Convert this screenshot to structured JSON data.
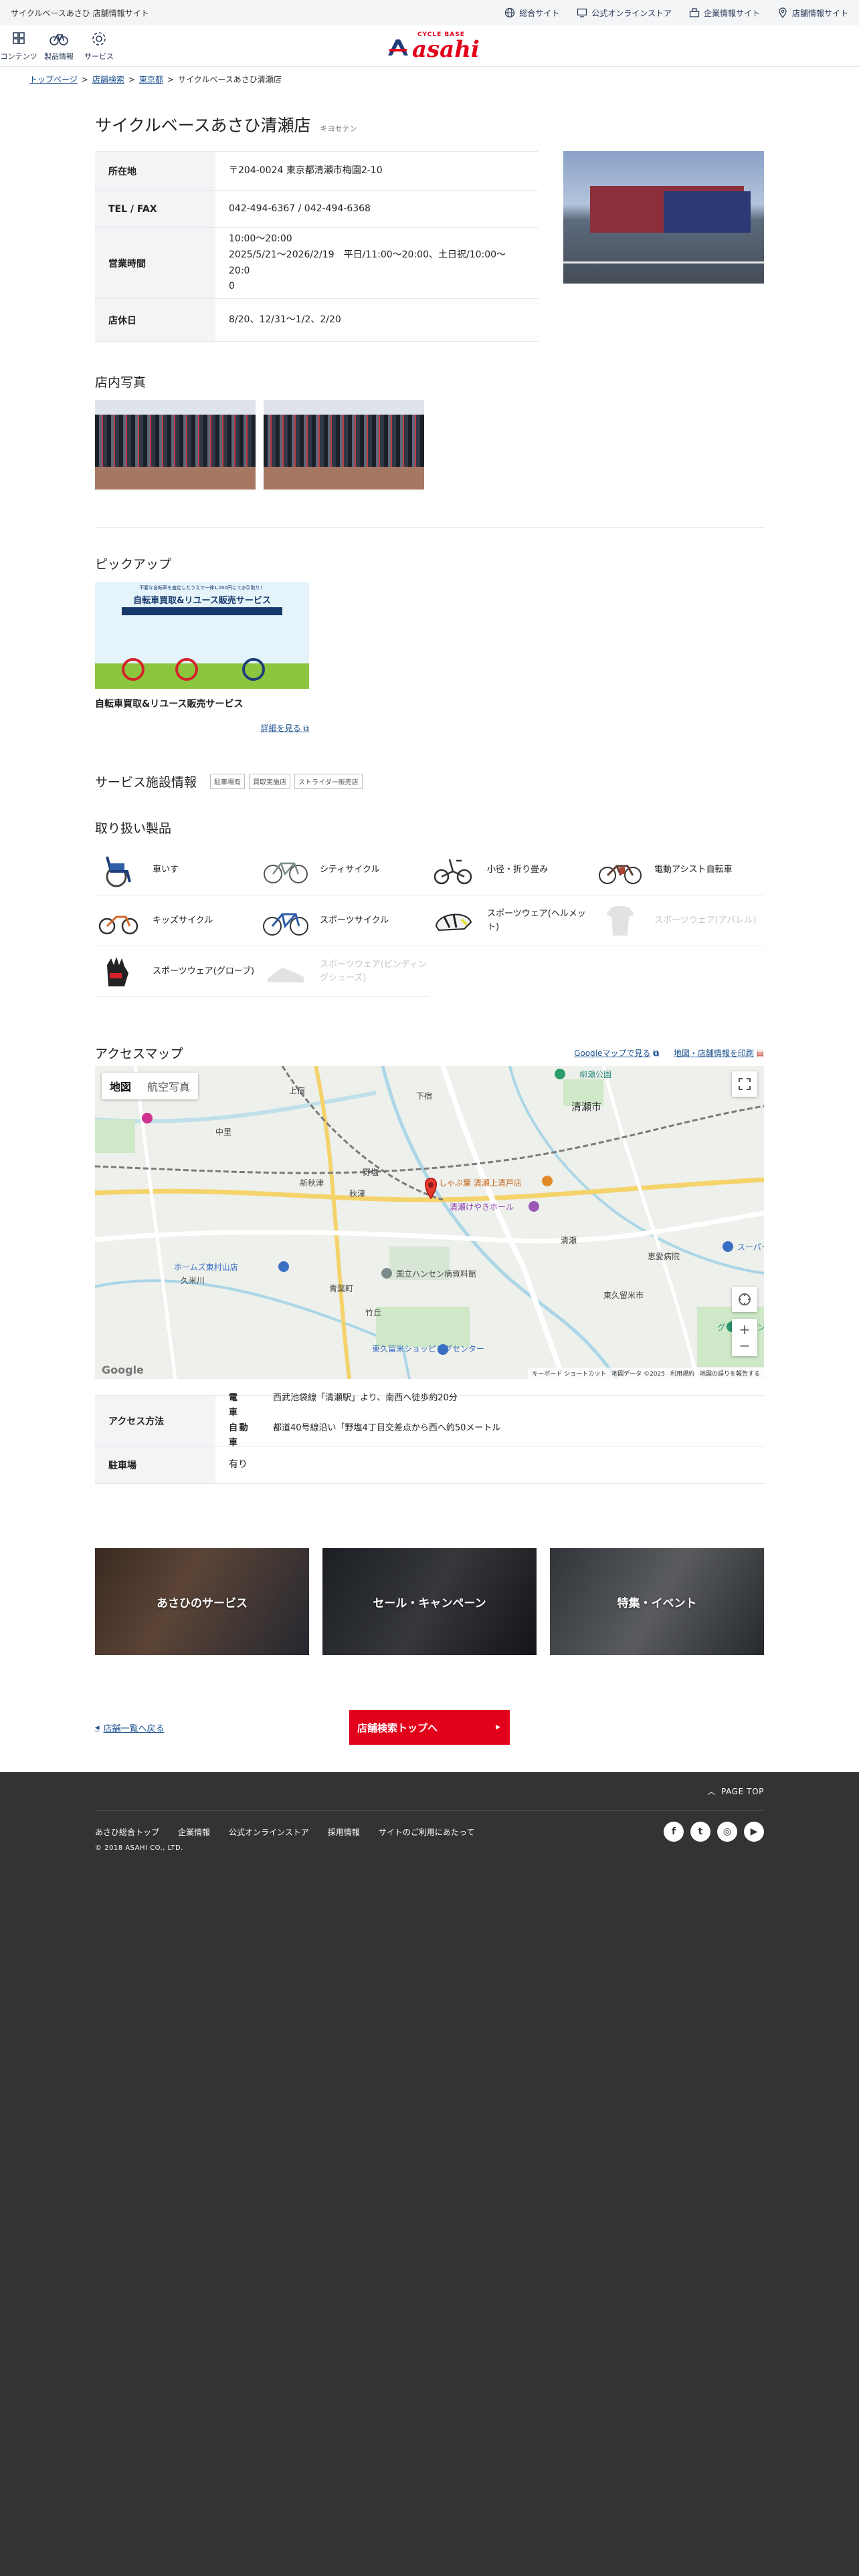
{
  "topbar": {
    "site_title": "サイクルベースあさひ 店舗情報サイト",
    "links": [
      {
        "label": "総合サイト",
        "icon": "globe-icon"
      },
      {
        "label": "公式オンラインストア",
        "icon": "monitor-icon"
      },
      {
        "label": "企業情報サイト",
        "icon": "building-icon"
      },
      {
        "label": "店舗情報サイト",
        "icon": "pin-icon"
      }
    ]
  },
  "header": {
    "nav": [
      {
        "label": "コンテンツ",
        "icon": "grid-icon"
      },
      {
        "label": "製品情報",
        "icon": "bicycle-icon"
      },
      {
        "label": "サービス",
        "icon": "gear-icon"
      }
    ],
    "logo_small": "CYCLE BASE",
    "logo_big": "asahi"
  },
  "breadcrumb": {
    "items": [
      "トップページ",
      "店舗検索",
      "東京都"
    ],
    "current": "サイクルベースあさひ清瀬店",
    "separator": ">"
  },
  "shop": {
    "name": "サイクルベースあさひ清瀬店",
    "kana": "キヨセテン",
    "info": [
      {
        "label": "所在地",
        "lines": [
          "〒204-0024 東京都清瀬市梅園2-10"
        ]
      },
      {
        "label": "TEL / FAX",
        "lines": [
          "042-494-6367 / 042-494-6368"
        ]
      },
      {
        "label": "営業時間",
        "lines": [
          "10:00～20:00",
          "2025/5/21～2026/2/19　平日/11:00～20:00、土日祝/10:00～20:0",
          "0"
        ]
      },
      {
        "label": "店休日",
        "lines": [
          "8/20、12/31～1/2、2/20"
        ]
      }
    ]
  },
  "photos_section": {
    "title": "店内写真"
  },
  "pickup": {
    "title": "ピックアップ",
    "banner_small": "不要な自転車を査定したうえで一律1,000円にてお引取り！",
    "banner_big": "自転車買取&リユース販売サービス",
    "card_title": "自転車買取&リユース販売サービス",
    "more": "詳細を見る"
  },
  "services": {
    "title": "サービス施設情報",
    "tags": [
      "駐車場有",
      "買取実施店",
      "ストライダー販売店"
    ]
  },
  "products": {
    "title": "取り扱い製品",
    "items": [
      {
        "label": "車いす",
        "icon": "wheelchair-icon",
        "enabled": true
      },
      {
        "label": "シティサイクル",
        "icon": "city-bike-icon",
        "enabled": true
      },
      {
        "label": "小径・折り畳み",
        "icon": "folding-bike-icon",
        "enabled": true
      },
      {
        "label": "電動アシスト自転車",
        "icon": "e-bike-icon",
        "enabled": true
      },
      {
        "label": "キッズサイクル",
        "icon": "kids-bike-icon",
        "enabled": true
      },
      {
        "label": "スポーツサイクル",
        "icon": "sports-bike-icon",
        "enabled": true
      },
      {
        "label": "スポーツウェア(ヘルメット)",
        "icon": "helmet-icon",
        "enabled": true
      },
      {
        "label": "スポーツウェア(アパレル)",
        "icon": "shirt-icon",
        "enabled": false
      },
      {
        "label": "スポーツウェア(グローブ)",
        "icon": "glove-icon",
        "enabled": true
      },
      {
        "label": "スポーツウェア(ビンディングシューズ)",
        "icon": "shoe-icon",
        "enabled": false
      }
    ]
  },
  "access": {
    "title": "アクセスマップ",
    "map_link": "Googleマップで見る",
    "print_link": "地図・店舗情報を印刷",
    "map_tabs": [
      "地図",
      "航空写真"
    ],
    "map_labels": [
      "清瀬市",
      "上宿",
      "下宿",
      "柳瀬公園",
      "中里",
      "野塩",
      "新秋津",
      "秋津",
      "しゃぶ葉 清瀬上清戸店",
      "清瀬けやきホール",
      "国立ハンセン病資料館",
      "恵愛病院",
      "東久留米市",
      "ホームズ東村山店",
      "スーパー",
      "久米川",
      "青葉町",
      "清瀬",
      "竹丘",
      "グランキャンプ",
      "東久留米ショッピングセンター"
    ],
    "map_attribution": [
      "キーボード ショートカット",
      "地図データ ©2025",
      "利用規約",
      "地図の誤りを報告する"
    ],
    "map_brand": "Google",
    "rows": [
      {
        "label": "アクセス方法",
        "lines": [
          {
            "kind": "電　車",
            "text": "西武池袋線「清瀬駅」より、南西へ徒歩約20分"
          },
          {
            "kind": "自動車",
            "text": "都道40号線沿い「野塩4丁目交差点から西へ約50メートル"
          }
        ]
      },
      {
        "label": "駐車場",
        "value": "有り"
      }
    ]
  },
  "banners": [
    "あさひのサービス",
    "セール・キャンペーン",
    "特集・イベント"
  ],
  "bottom_nav": {
    "back": "店舗一覧へ戻る",
    "top": "店舗検索トップへ"
  },
  "footer": {
    "page_top": "PAGE TOP",
    "links": [
      "あさひ総合トップ",
      "企業情報",
      "公式オンラインストア",
      "採用情報",
      "サイトのご利用にあたって"
    ],
    "copyright": "© 2018 ASAHI CO., LTD.",
    "social": [
      "facebook-icon",
      "twitter-icon",
      "instagram-icon",
      "youtube-icon"
    ]
  },
  "colors": {
    "brand_red": "#e2001a",
    "navy": "#2a3b58",
    "footer_bg": "#333333"
  }
}
